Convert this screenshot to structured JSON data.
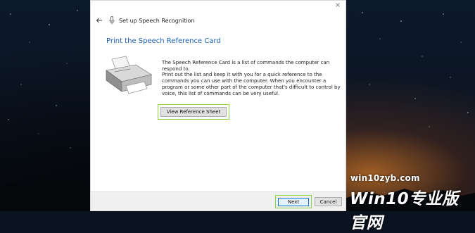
{
  "window": {
    "close_glyph": "×",
    "header_title": "Set up Speech Recognition"
  },
  "page": {
    "heading": "Print the Speech Reference Card",
    "paragraph1": "The Speech Reference Card is a list of commands the computer can respond to.",
    "paragraph2": "Print out the list and keep it with you for a quick reference to the commands you can use with the computer. When you encounter a program or some other part of the computer that's difficult to control by voice, this list of commands can be very useful.",
    "view_reference_label": "View Reference Sheet"
  },
  "footer": {
    "next_label": "Next",
    "cancel_label": "Cancel"
  },
  "watermark": {
    "site": "win10zyb.com",
    "logo": "Win10专业版官网"
  },
  "colors": {
    "accent_highlight": "#8ed24a",
    "heading_blue": "#1b5fb4",
    "primary_button_border": "#0078d7"
  },
  "icons": {
    "back": "back-arrow-icon",
    "mic": "microphone-icon",
    "printer": "printer-icon",
    "close": "close-icon"
  }
}
